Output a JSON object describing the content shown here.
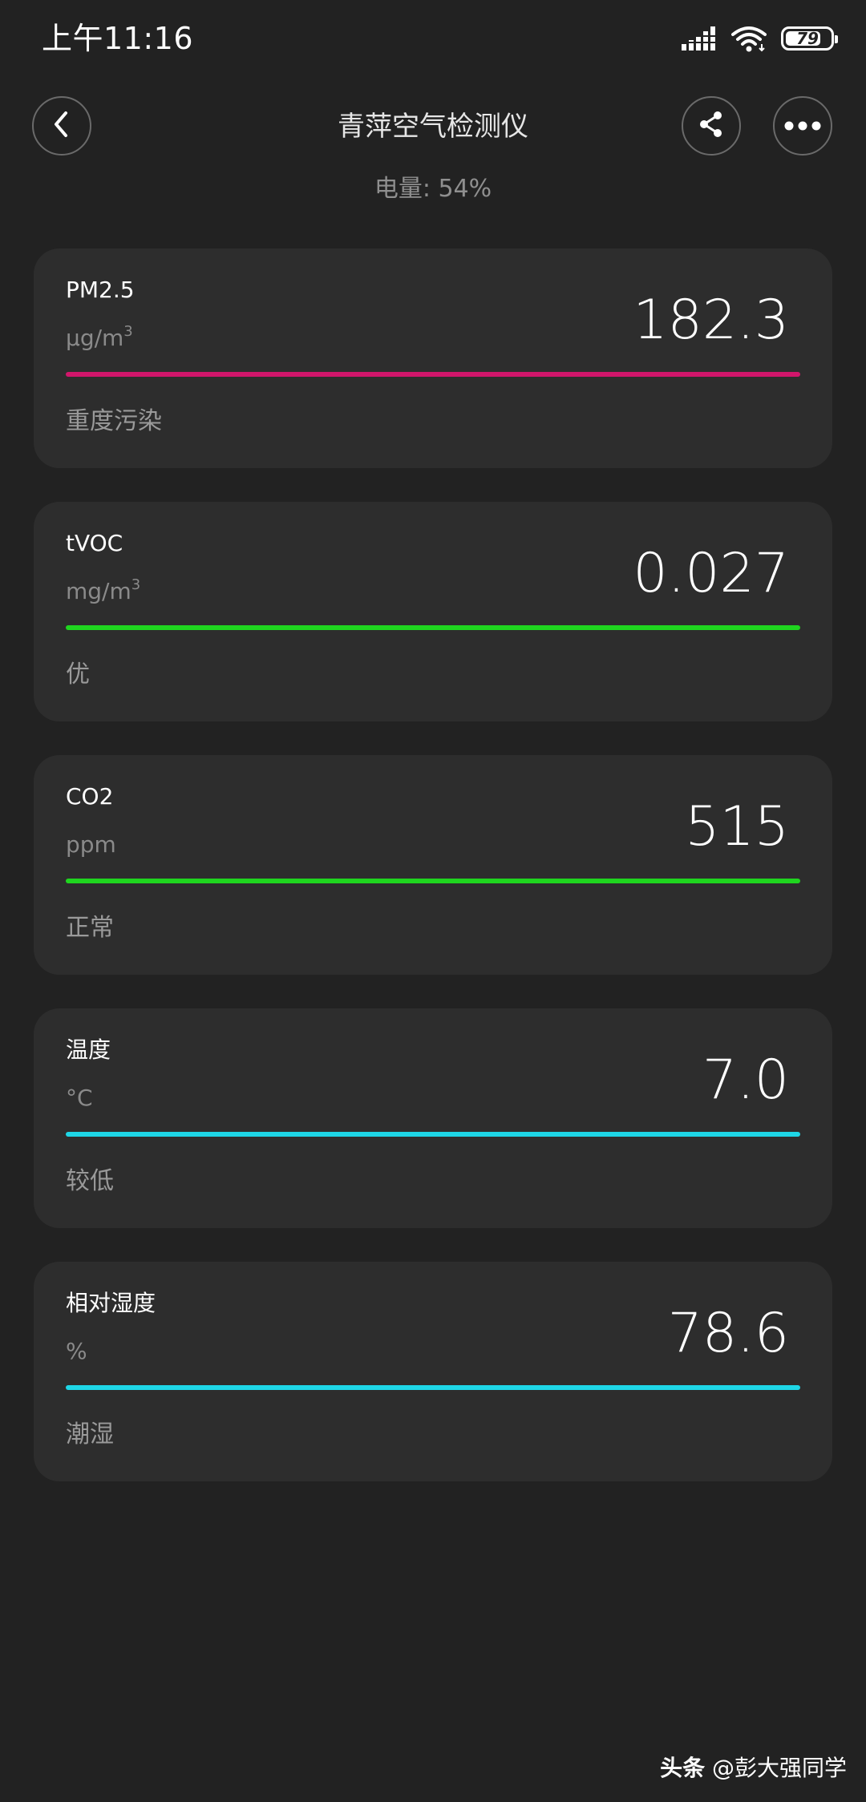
{
  "status_bar": {
    "time": "上午11:16",
    "battery_level": "79",
    "battery_fraction": 0.79,
    "icons": [
      "signal-icon",
      "wifi-icon",
      "battery-icon"
    ]
  },
  "header": {
    "title": "青萍空气检测仪",
    "battery_text": "电量: 54%",
    "icons": [
      "chevron-left-icon",
      "share-icon",
      "more-dots-icon"
    ]
  },
  "metrics": [
    {
      "name": "PM2.5",
      "unit_base": "μg/m",
      "unit_sup": "3",
      "value": "182.3",
      "status": "重度污染",
      "color": "#d1166b"
    },
    {
      "name": "tVOC",
      "unit_base": "mg/m",
      "unit_sup": "3",
      "value": "0.027",
      "status": "优",
      "color": "#1fd51f"
    },
    {
      "name": "CO2",
      "unit_base": "ppm",
      "unit_sup": "",
      "value": "515",
      "status": "正常",
      "color": "#1fd51f"
    },
    {
      "name": "温度",
      "unit_base": "°C",
      "unit_sup": "",
      "value": "7.0",
      "status": "较低",
      "color": "#1ed6e6"
    },
    {
      "name": "相对湿度",
      "unit_base": "%",
      "unit_sup": "",
      "value": "78.6",
      "status": "潮湿",
      "color": "#1ed6e6"
    }
  ],
  "watermark": {
    "brand": "头条",
    "author": "@彭大强同学"
  }
}
